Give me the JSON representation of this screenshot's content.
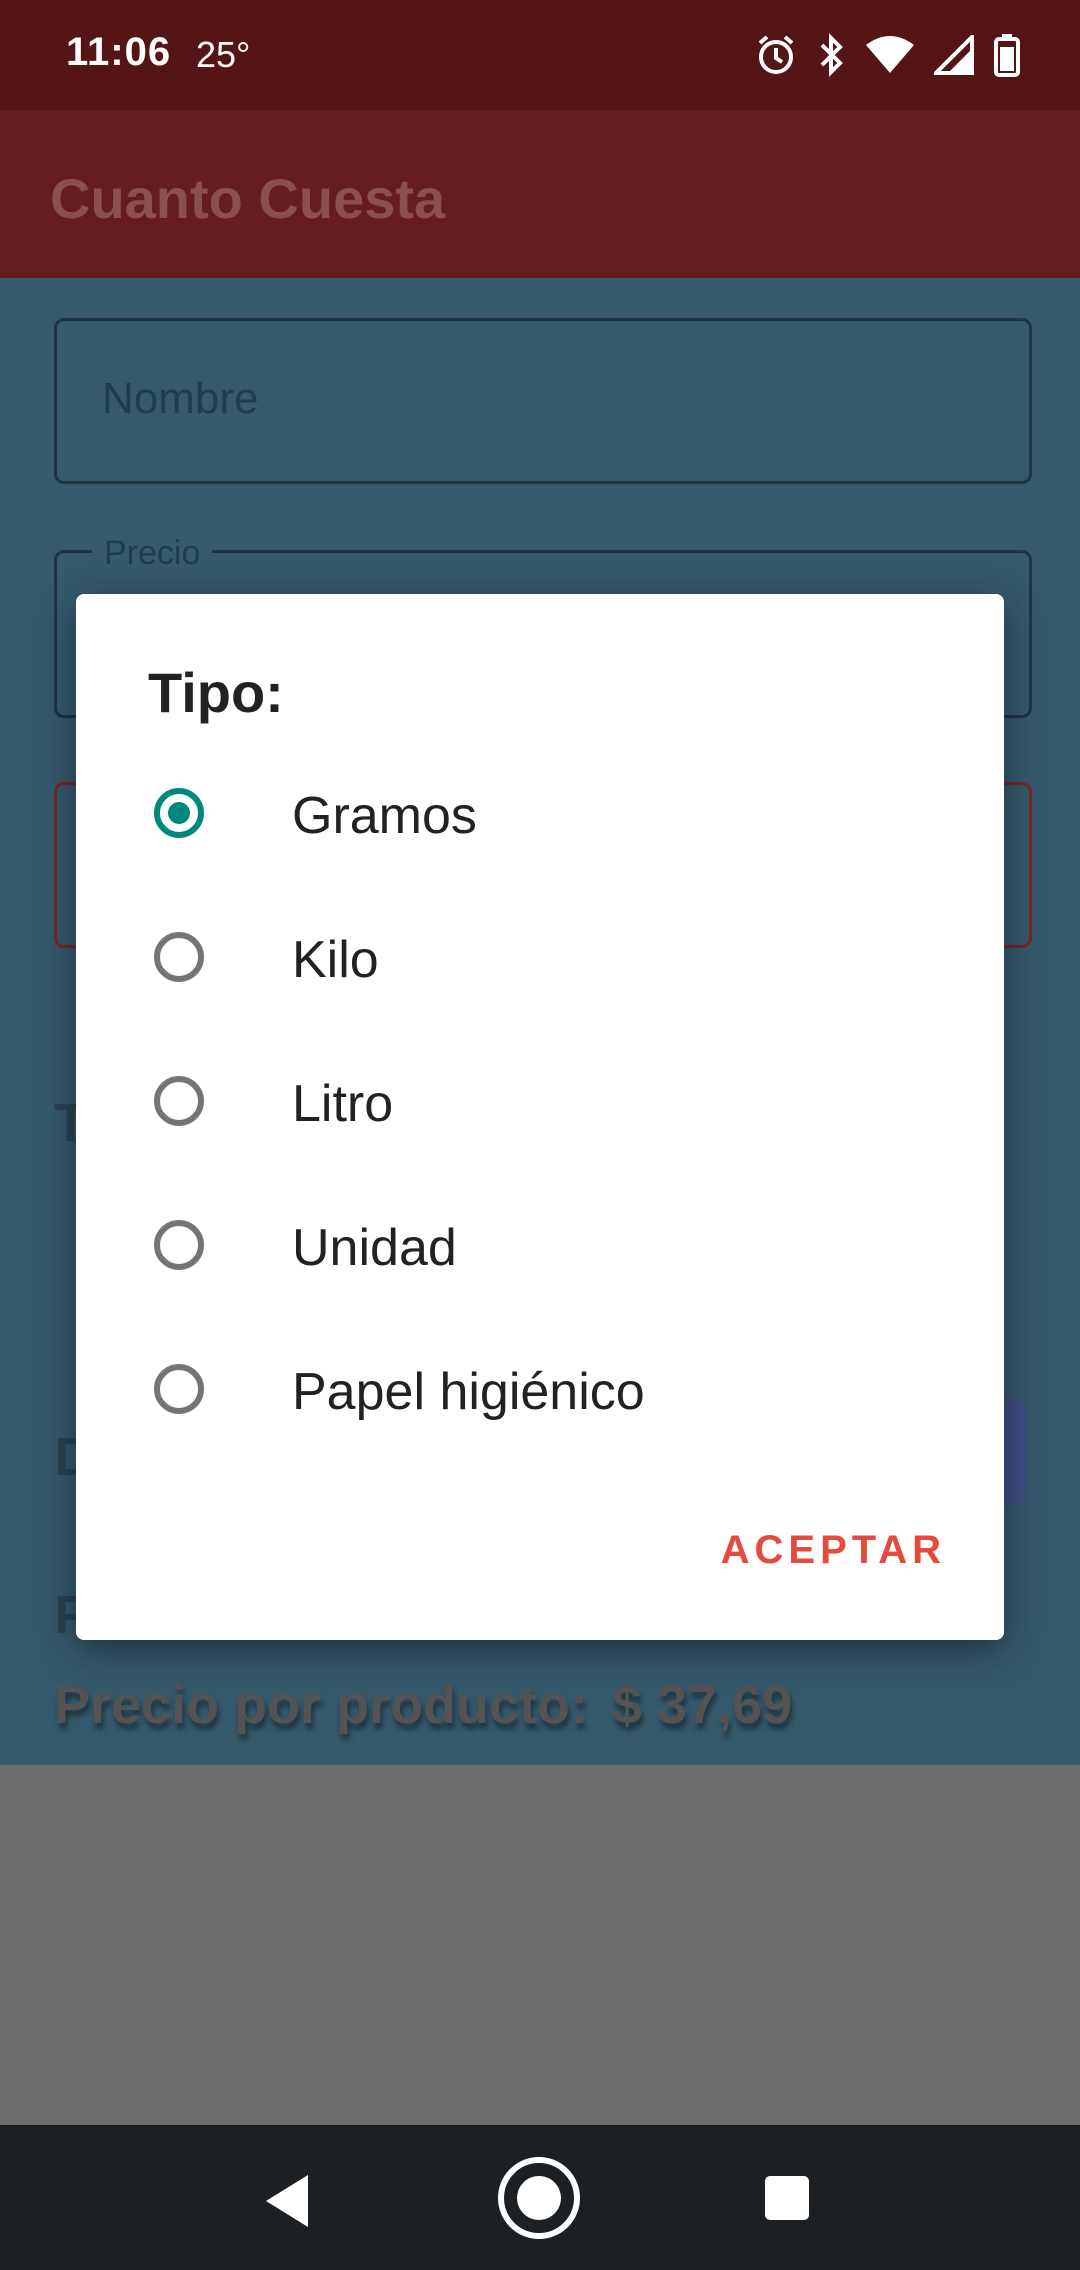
{
  "status_bar": {
    "time": "11:06",
    "temperature": "25°",
    "icons": [
      "alarm-icon",
      "bluetooth-icon",
      "wifi-icon",
      "cell-signal-icon",
      "battery-icon"
    ]
  },
  "app_bar": {
    "title": "Cuanto Cuesta"
  },
  "form": {
    "nombre_label": "Nombre",
    "precio_label": "Precio",
    "partial_t": "T",
    "partial_d": "D",
    "partial_p": "P",
    "precio_por_producto_label": "Precio por producto:",
    "precio_por_producto_value": "$ 37,69"
  },
  "dialog": {
    "title": "Tipo:",
    "options": [
      {
        "label": "Gramos",
        "selected": true
      },
      {
        "label": "Kilo",
        "selected": false
      },
      {
        "label": "Litro",
        "selected": false
      },
      {
        "label": "Unidad",
        "selected": false
      },
      {
        "label": "Papel higiénico",
        "selected": false
      }
    ],
    "accept_label": "ACEPTAR"
  },
  "nav_bar": {
    "icons": [
      "back-icon",
      "home-icon",
      "recents-icon"
    ]
  },
  "colors": {
    "status_bar": "#551514",
    "app_bar": "#661d1d",
    "content_dimmed": "#355a6c",
    "radio_selected": "#00897b",
    "accept_button": "#e64a3c",
    "nav_bar": "#1c2023"
  }
}
